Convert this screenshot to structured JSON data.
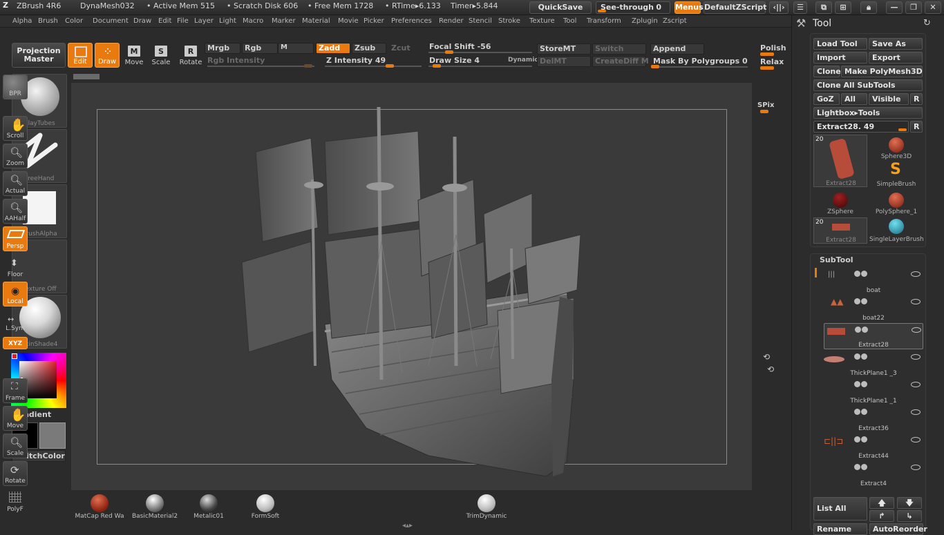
{
  "title": {
    "app": "ZBrush 4R6",
    "doc": "DynaMesh032",
    "active_mem": "• Active Mem 515",
    "scratch": "• Scratch Disk 606",
    "free_mem": "• Free Mem 1728",
    "rtime": "• RTime▸6.133",
    "timer": "Timer▸5.844",
    "quicksave": "QuickSave",
    "seethrough": "See-through",
    "seethrough_val": "0",
    "menus": "Menus",
    "defaultzscript": "DefaultZScript"
  },
  "menubar": [
    "Alpha",
    "Brush",
    "Color",
    "Document",
    "Draw",
    "Edit",
    "File",
    "Layer",
    "Light",
    "Macro",
    "Marker",
    "Material",
    "Movie",
    "Picker",
    "Preferences",
    "Render",
    "Stencil",
    "Stroke",
    "Texture",
    "Tool",
    "Transform",
    "Zplugin",
    "Zscript"
  ],
  "toolbar": {
    "projection_master": "Projection Master",
    "edit": "Edit",
    "draw": "Draw",
    "move": "Move",
    "scale": "Scale",
    "rotate": "Rotate",
    "mrgb": "Mrgb",
    "rgb": "Rgb",
    "m": "M",
    "rgb_intensity": "Rgb Intensity",
    "zadd": "Zadd",
    "zsub": "Zsub",
    "zcut": "Zcut",
    "z_intensity": "Z Intensity 49",
    "focal_shift": "Focal Shift -56",
    "draw_size": "Draw Size 4",
    "dynamic": "Dynamic",
    "storemt": "StoreMT",
    "delmt": "DelMT",
    "switch": "Switch",
    "creatediff": "CreateDiff M",
    "append": "Append",
    "mask_by_polygroups": "Mask By Polygroups 0",
    "polish": "Polish",
    "relax": "Relax"
  },
  "leftshelf": {
    "brush": "ClayTubes",
    "stroke": "FreeHand",
    "alpha": "BrushAlpha",
    "texture": "Texture Off",
    "material": "SkinShade4",
    "gradient": "Gradient",
    "switchcolor": "SwitchColor"
  },
  "rightshelf": [
    "BPR",
    "SPix",
    "Scroll",
    "Zoom",
    "Actual",
    "AAHalf",
    "Persp",
    "Floor",
    "Local",
    "L.Sym",
    "XYZ",
    "Frame",
    "Move",
    "Scale",
    "Rotate",
    "PolyF"
  ],
  "panel": {
    "title": "Tool",
    "load_tool": "Load Tool",
    "save_as": "Save As",
    "import": "Import",
    "export": "Export",
    "clone": "Clone",
    "make_polymesh": "Make PolyMesh3D",
    "clone_all": "Clone All SubTools",
    "goz": "GoZ",
    "all": "All",
    "visible": "Visible",
    "r": "R",
    "lightbox_tools": "Lightbox▸Tools",
    "current_tool": "Extract28. 49",
    "tools": [
      {
        "name": "Extract28",
        "badge": "20"
      },
      {
        "name": "Sphere3D"
      },
      {
        "name": "SimpleBrush"
      },
      {
        "name": "ZSphere"
      },
      {
        "name": "PolySphere_1"
      },
      {
        "name": "Extract28",
        "badge": "20"
      },
      {
        "name": "SingleLayerBrush"
      }
    ],
    "subtool_title": "SubTool",
    "subtools": [
      "boat",
      "boat22",
      "Extract28",
      "ThickPlane1 _3",
      "ThickPlane1 _1",
      "Extract36",
      "Extract44",
      "Extract4"
    ],
    "list_all": "List All",
    "rename": "Rename",
    "autoreorder": "AutoReorder"
  },
  "materials": [
    "MatCap Red Wa",
    "BasicMaterial2",
    "Metalic01",
    "FormSoft",
    "TrimDynamic"
  ],
  "colors": {
    "accent": "#e87a10",
    "bg": "#2b2b2b",
    "canvas": "#3a3a3a"
  }
}
